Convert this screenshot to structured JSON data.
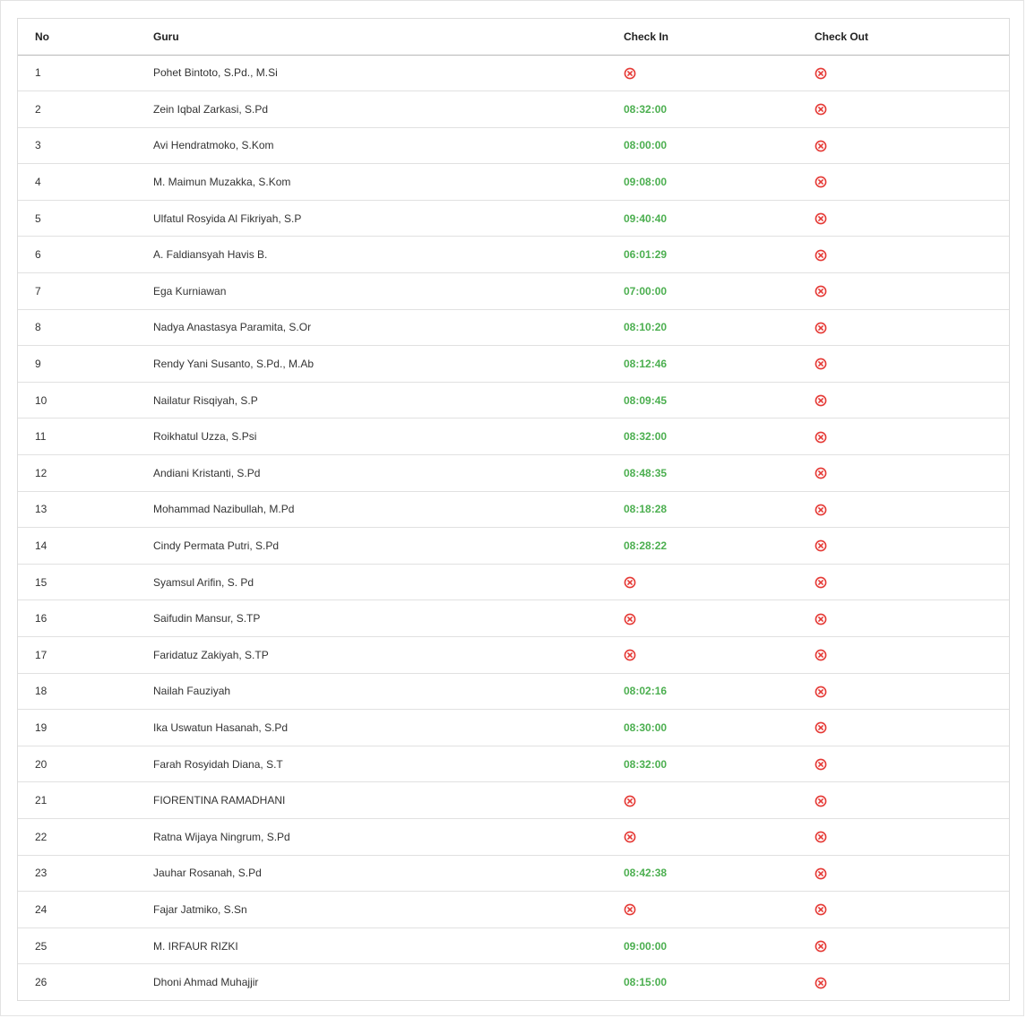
{
  "colors": {
    "checked_in": "#4caf50",
    "missing": "#e53935"
  },
  "table": {
    "headers": {
      "no": "No",
      "guru": "Guru",
      "check_in": "Check In",
      "check_out": "Check Out"
    },
    "missing_icon": "circle-x-icon",
    "rows": [
      {
        "no": "1",
        "guru": "Pohet Bintoto, S.Pd., M.Si",
        "check_in": null,
        "check_out": null
      },
      {
        "no": "2",
        "guru": "Zein Iqbal Zarkasi, S.Pd",
        "check_in": "08:32:00",
        "check_out": null
      },
      {
        "no": "3",
        "guru": "Avi Hendratmoko, S.Kom",
        "check_in": "08:00:00",
        "check_out": null
      },
      {
        "no": "4",
        "guru": "M. Maimun Muzakka, S.Kom",
        "check_in": "09:08:00",
        "check_out": null
      },
      {
        "no": "5",
        "guru": "Ulfatul Rosyida Al Fikriyah, S.P",
        "check_in": "09:40:40",
        "check_out": null
      },
      {
        "no": "6",
        "guru": "A. Faldiansyah Havis B.",
        "check_in": "06:01:29",
        "check_out": null
      },
      {
        "no": "7",
        "guru": "Ega Kurniawan",
        "check_in": "07:00:00",
        "check_out": null
      },
      {
        "no": "8",
        "guru": "Nadya Anastasya Paramita, S.Or",
        "check_in": "08:10:20",
        "check_out": null
      },
      {
        "no": "9",
        "guru": "Rendy Yani Susanto, S.Pd., M.Ab",
        "check_in": "08:12:46",
        "check_out": null
      },
      {
        "no": "10",
        "guru": "Nailatur Risqiyah, S.P",
        "check_in": "08:09:45",
        "check_out": null
      },
      {
        "no": "11",
        "guru": "Roikhatul Uzza, S.Psi",
        "check_in": "08:32:00",
        "check_out": null
      },
      {
        "no": "12",
        "guru": "Andiani Kristanti, S.Pd",
        "check_in": "08:48:35",
        "check_out": null
      },
      {
        "no": "13",
        "guru": "Mohammad Nazibullah, M.Pd",
        "check_in": "08:18:28",
        "check_out": null
      },
      {
        "no": "14",
        "guru": "Cindy Permata Putri, S.Pd",
        "check_in": "08:28:22",
        "check_out": null
      },
      {
        "no": "15",
        "guru": "Syamsul Arifin, S. Pd",
        "check_in": null,
        "check_out": null
      },
      {
        "no": "16",
        "guru": "Saifudin Mansur, S.TP",
        "check_in": null,
        "check_out": null
      },
      {
        "no": "17",
        "guru": "Faridatuz Zakiyah, S.TP",
        "check_in": null,
        "check_out": null
      },
      {
        "no": "18",
        "guru": "Nailah Fauziyah",
        "check_in": "08:02:16",
        "check_out": null
      },
      {
        "no": "19",
        "guru": "Ika Uswatun Hasanah, S.Pd",
        "check_in": "08:30:00",
        "check_out": null
      },
      {
        "no": "20",
        "guru": "Farah Rosyidah Diana, S.T",
        "check_in": "08:32:00",
        "check_out": null
      },
      {
        "no": "21",
        "guru": "FIORENTINA RAMADHANI",
        "check_in": null,
        "check_out": null
      },
      {
        "no": "22",
        "guru": "Ratna Wijaya Ningrum, S.Pd",
        "check_in": null,
        "check_out": null
      },
      {
        "no": "23",
        "guru": "Jauhar Rosanah, S.Pd",
        "check_in": "08:42:38",
        "check_out": null
      },
      {
        "no": "24",
        "guru": "Fajar Jatmiko, S.Sn",
        "check_in": null,
        "check_out": null
      },
      {
        "no": "25",
        "guru": "M. IRFAUR RIZKI",
        "check_in": "09:00:00",
        "check_out": null
      },
      {
        "no": "26",
        "guru": "Dhoni Ahmad Muhajjir",
        "check_in": "08:15:00",
        "check_out": null
      }
    ]
  }
}
